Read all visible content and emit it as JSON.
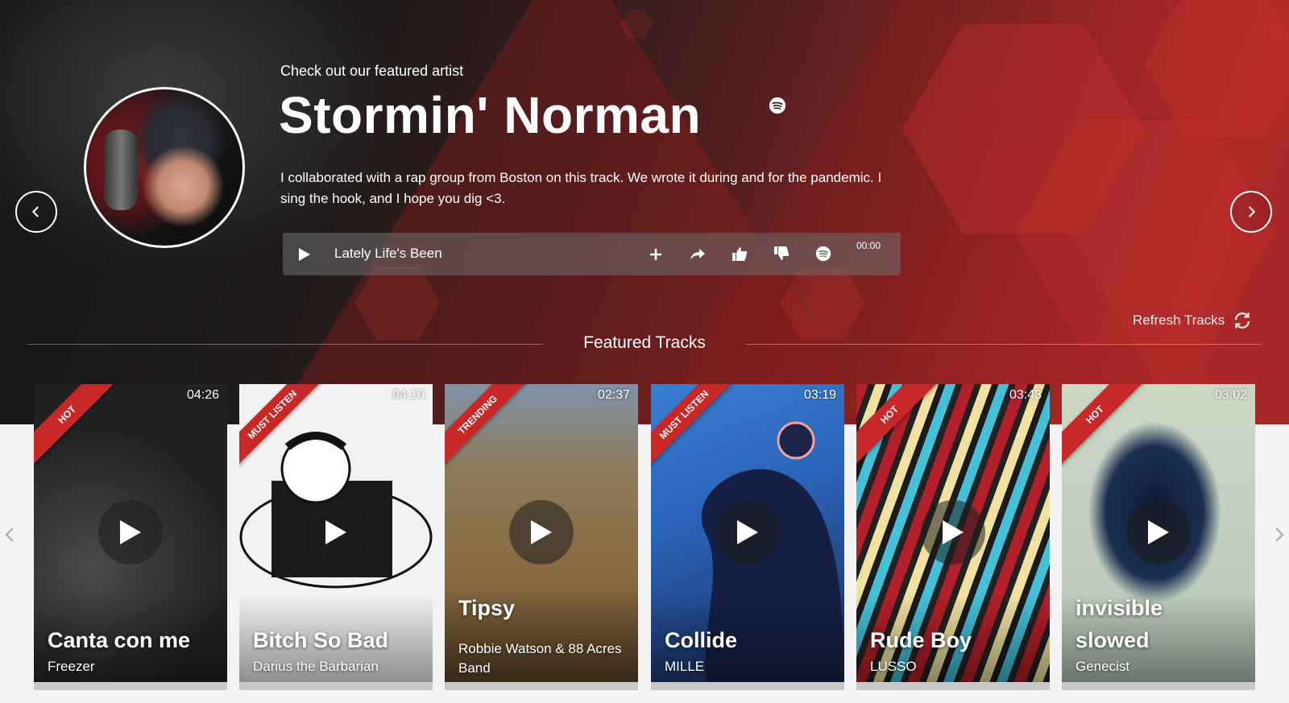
{
  "hero": {
    "eyebrow": "Check out our featured artist",
    "artist_name": "Stormin' Norman",
    "bio": "I collaborated with a rap group from Boston on this track. We wrote it during and for the pandemic. I sing the hook, and I hope you dig <3.",
    "player": {
      "track_name": "Lately Life's Been",
      "time": "00:00"
    }
  },
  "featured": {
    "title": "Featured Tracks",
    "refresh_label": "Refresh Tracks",
    "cards": [
      {
        "title": "Canta con me",
        "artist": "Freezer",
        "duration": "04:26",
        "badge": "HOT"
      },
      {
        "title": "Bitch So Bad",
        "artist": "Darius the Barbarian",
        "duration": "04:10",
        "badge": "MUST LISTEN"
      },
      {
        "title": "Tipsy",
        "artist": "Robbie Watson & 88 Acres Band",
        "duration": "02:37",
        "badge": "TRENDING"
      },
      {
        "title": "Collide",
        "artist": "MILLE",
        "duration": "03:19",
        "badge": "MUST LISTEN"
      },
      {
        "title": "Rude Boy",
        "artist": "LUSSO",
        "duration": "03:43",
        "badge": "HOT"
      },
      {
        "title": "invisible slowed",
        "artist": "Genecist",
        "duration": "03:02",
        "badge": "HOT"
      }
    ]
  },
  "colors": {
    "accent": "#c92828",
    "hero_dark": "#141414",
    "hero_red": "#b02929"
  },
  "icons": {
    "prev": "chevron-left-icon",
    "next": "chevron-right-icon",
    "play": "play-icon",
    "add": "plus-icon",
    "share": "share-icon",
    "like": "thumbs-up-icon",
    "dislike": "thumbs-down-icon",
    "spotify": "spotify-icon",
    "refresh": "refresh-icon"
  }
}
